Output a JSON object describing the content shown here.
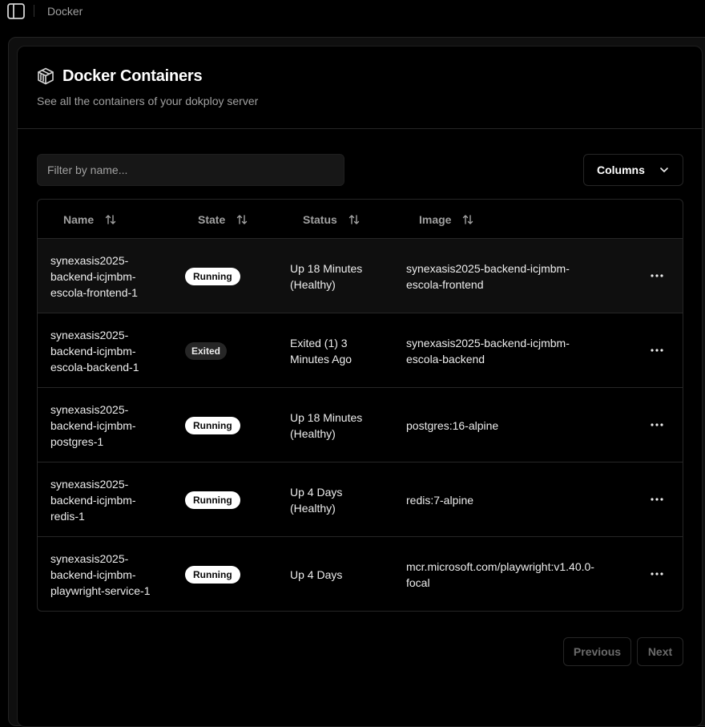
{
  "topbar": {
    "title": "Docker",
    "toggle_icon": "sidebar-panel-icon"
  },
  "header": {
    "icon": "container-box-icon",
    "title": "Docker Containers",
    "subtitle": "See all the containers of your dokploy server"
  },
  "filter": {
    "placeholder": "Filter by name...",
    "value": ""
  },
  "columns_button": {
    "label": "Columns",
    "icon": "chevron-down-icon"
  },
  "table": {
    "headers": [
      "Name",
      "State",
      "Status",
      "Image"
    ],
    "rows": [
      {
        "name": "synexasis2025-\nbackend-icjmbm-\nescola-frontend-1",
        "state": "Running",
        "status": "Up 18 Minutes\n(Healthy)",
        "image": "synexasis2025-backend-icjmbm-\nescola-frontend"
      },
      {
        "name": "synexasis2025-\nbackend-icjmbm-\nescola-backend-1",
        "state": "Exited",
        "status": "Exited (1) 3\nMinutes Ago",
        "image": "synexasis2025-backend-icjmbm-\nescola-backend"
      },
      {
        "name": "synexasis2025-\nbackend-icjmbm-\npostgres-1",
        "state": "Running",
        "status": "Up 18 Minutes\n(Healthy)",
        "image": "postgres:16-alpine"
      },
      {
        "name": "synexasis2025-\nbackend-icjmbm-\nredis-1",
        "state": "Running",
        "status": "Up 4 Days\n(Healthy)",
        "image": "redis:7-alpine"
      },
      {
        "name": "synexasis2025-\nbackend-icjmbm-\nplaywright-service-1",
        "state": "Running",
        "status": "Up 4 Days",
        "image": "mcr.microsoft.com/playwright:v1.40.0-\nfocal"
      }
    ]
  },
  "pagination": {
    "previous": "Previous",
    "next": "Next"
  },
  "colors": {
    "background": "#000000",
    "border": "#262626",
    "badge_running": "#ffffff",
    "badge_exited": "#262626",
    "muted_text": "#a1a1a1"
  }
}
